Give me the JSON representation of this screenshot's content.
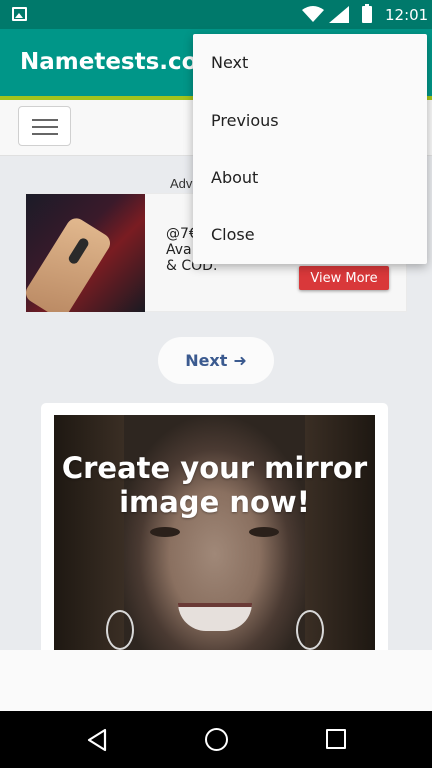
{
  "status_bar": {
    "time": "12:01",
    "icons": [
      "image-notification-icon",
      "wifi-icon",
      "cellular-signal-icon",
      "battery-icon"
    ]
  },
  "app_bar": {
    "title": "Nametests.com",
    "color": "#009688"
  },
  "site_header": {
    "menu_icon": "hamburger-menu-icon"
  },
  "ad": {
    "label": "Adv",
    "text": "@7€\nAva\n& COD.",
    "button_label": "View More",
    "button_color": "#d9383a"
  },
  "next_button": {
    "label": "Next",
    "icon": "arrow-right-icon",
    "color": "#3b5a8f"
  },
  "content_card": {
    "title": "Create your mirror image now!"
  },
  "overflow_menu": {
    "items": [
      {
        "label": "Next"
      },
      {
        "label": "Previous"
      },
      {
        "label": "About"
      },
      {
        "label": "Close"
      }
    ]
  },
  "nav_bar": {
    "icons": [
      "back-icon",
      "home-icon",
      "recents-icon"
    ]
  }
}
